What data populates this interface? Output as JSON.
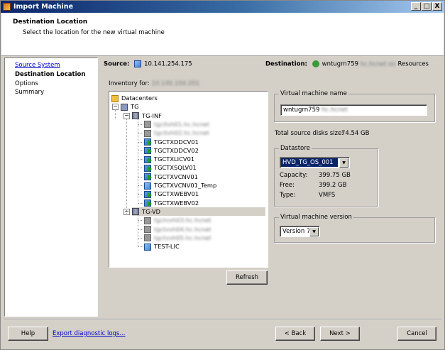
{
  "window": {
    "title": "Import Machine",
    "controls": [
      "_",
      "□",
      "X"
    ]
  },
  "header": {
    "title": "Destination Location",
    "subtitle": "Select the location for the new virtual machine"
  },
  "nav": {
    "items": [
      {
        "label": "Source System",
        "state": "link"
      },
      {
        "label": "Destination Location",
        "state": "current"
      },
      {
        "label": "Options",
        "state": "pending"
      },
      {
        "label": "Summary",
        "state": "pending"
      }
    ]
  },
  "source": {
    "label": "Source:",
    "value": "10.141.254.175"
  },
  "destination": {
    "label": "Destination:",
    "host": "wntugrn759",
    "blurred": "hc.hcnet on",
    "suffix": "Resources"
  },
  "inventory": {
    "label": "Inventory for:",
    "value": "10.140.104.201"
  },
  "tree": {
    "root": "Datacenters",
    "datacenter": "TG",
    "clusters": [
      {
        "name": "TG-INF",
        "items": [
          {
            "label": "tgcitvh01.hc.hcnet",
            "type": "host",
            "blurred": true
          },
          {
            "label": "tgcitvh02.hc.hcnet",
            "type": "host",
            "blurred": true
          },
          {
            "label": "TGCTXDDCV01",
            "type": "vm-on"
          },
          {
            "label": "TGCTXDDCV02",
            "type": "vm-on"
          },
          {
            "label": "TGCTXLICV01",
            "type": "vm-on"
          },
          {
            "label": "TGCTXSQLV01",
            "type": "vm-on"
          },
          {
            "label": "TGCTXVCNV01",
            "type": "vm-on"
          },
          {
            "label": "TGCTXVCNV01_Temp",
            "type": "vm-off"
          },
          {
            "label": "TGCTXWEBV01",
            "type": "vm-on"
          },
          {
            "label": "TGCTXWEBV02",
            "type": "vm-on"
          }
        ]
      },
      {
        "name": "TG-VD",
        "selected": true,
        "items": [
          {
            "label": "tgctvvh03.hc.hcnet",
            "type": "host",
            "blurred": true
          },
          {
            "label": "tgctvvh04.hc.hcnet",
            "type": "host",
            "blurred": true
          },
          {
            "label": "tgctvvh05.hc.hcnet",
            "type": "host",
            "blurred": true
          },
          {
            "label": "TEST-LIC",
            "type": "vm-off"
          }
        ]
      }
    ]
  },
  "refresh_label": "Refresh",
  "vm_name": {
    "label": "Virtual machine name",
    "value": "wntugrn759",
    "blurred": "hc.hcnet"
  },
  "disk_size": {
    "label": "Total source disks size:",
    "value": "74.54 GB"
  },
  "datastore": {
    "label": "Datastore",
    "selected": "HVD_TG_OS_001",
    "capacity_label": "Capacity:",
    "capacity": "399.75 GB",
    "free_label": "Free:",
    "free": "399.2 GB",
    "type_label": "Type:",
    "type": "VMFS"
  },
  "vm_version": {
    "label": "Virtual machine version",
    "selected": "Version 7"
  },
  "footer": {
    "help": "Help",
    "export": "Export diagnostic logs...",
    "back": "< Back",
    "next": "Next >",
    "cancel": "Cancel"
  },
  "colors": {
    "titlebar": "#0a246a",
    "selection": "#0a246a",
    "link": "#0000cc",
    "face": "#d4d0c8"
  }
}
